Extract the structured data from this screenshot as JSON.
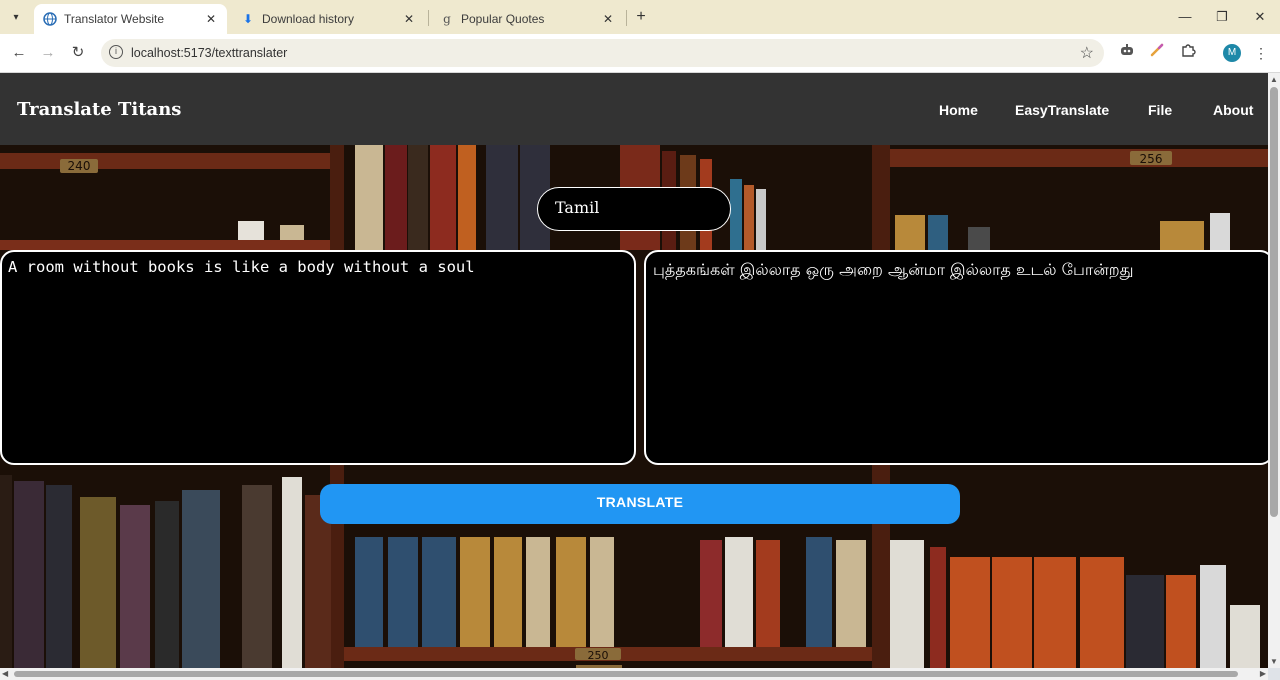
{
  "browser": {
    "tabs": [
      {
        "title": "Translator Website",
        "icon": "globe-icon",
        "active": true
      },
      {
        "title": "Download history",
        "icon": "download-icon",
        "active": false
      },
      {
        "title": "Popular Quotes",
        "icon": "goodreads-icon",
        "active": false
      }
    ],
    "url": "localhost:5173/texttranslater",
    "profile_initial": "M"
  },
  "header": {
    "brand": "Translate Titans",
    "nav": [
      "Home",
      "EasyTranslate",
      "File",
      "About"
    ]
  },
  "translator": {
    "selected_language": "Tamil",
    "source_text": "A room without books is like a body without a soul",
    "translated_text": "புத்தகங்கள் இல்லாத ஒரு அறை ஆன்மா இல்லாத உடல் போன்றது",
    "button_label": "TRANSLATE"
  },
  "colors": {
    "header_bg": "#333333",
    "button_bg": "#2196f3",
    "textbox_bg": "#000000",
    "tabbar_bg": "#efe9cf"
  },
  "background_scene": {
    "shelf_labels": [
      "240",
      "256",
      "250"
    ]
  }
}
